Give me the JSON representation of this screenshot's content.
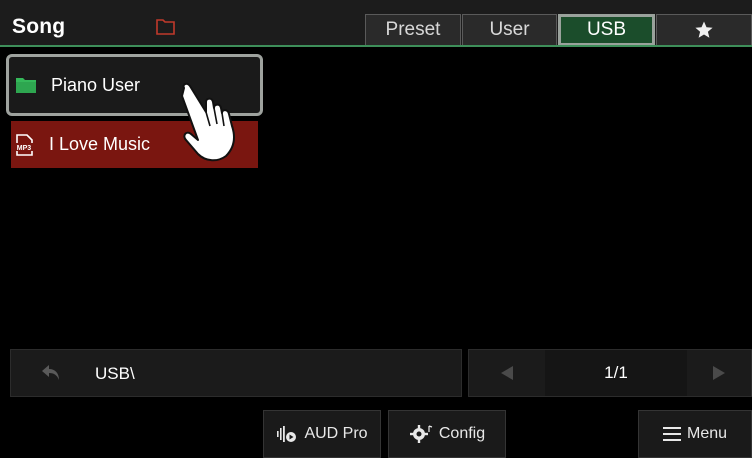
{
  "header": {
    "title": "Song",
    "tabs": [
      {
        "label": "Preset",
        "active": false
      },
      {
        "label": "User",
        "active": false
      },
      {
        "label": "USB",
        "active": true
      },
      {
        "label": "",
        "icon": "star-icon",
        "active": false
      }
    ]
  },
  "files": [
    {
      "name": "Piano User",
      "type": "folder",
      "icon": "folder-icon",
      "state": "focused"
    },
    {
      "name": "I Love Music",
      "type": "mp3",
      "icon": "mp3-file-icon",
      "state": "selected"
    }
  ],
  "path": {
    "value": "USB\\"
  },
  "pager": {
    "page": "1/1"
  },
  "buttons": {
    "aud_pro": "AUD Pro",
    "config": "Config",
    "menu": "Menu"
  },
  "colors": {
    "accent_green": "#1b4d2b",
    "header_line": "#3e8f5a",
    "selected_red": "#7a1610",
    "folder_green": "#35b85a"
  }
}
